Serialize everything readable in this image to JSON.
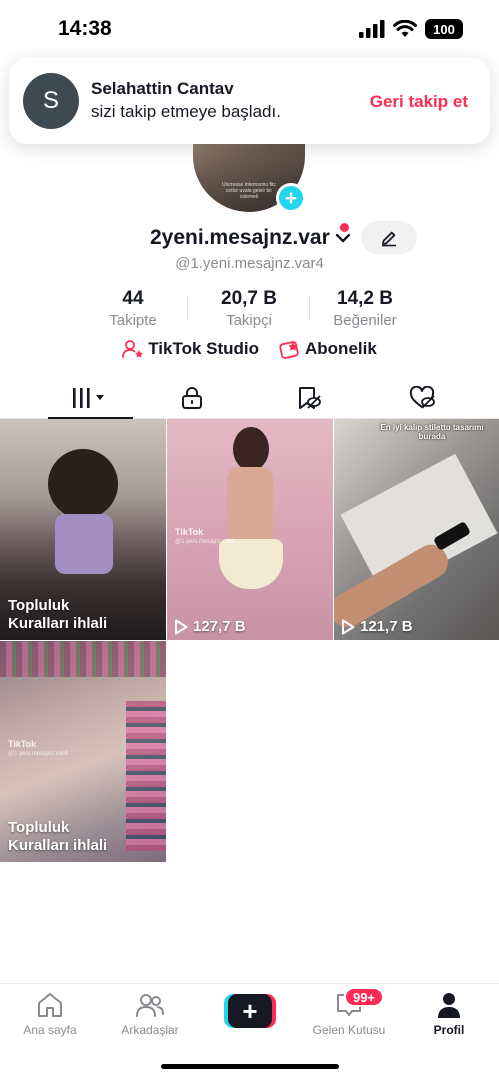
{
  "status_bar": {
    "time": "14:38",
    "battery": "100"
  },
  "notification": {
    "avatar_letter": "S",
    "name": "Selahattin Cantav",
    "message": "sizi takip etmeye başladı.",
    "action": "Geri takip et"
  },
  "profile": {
    "pic_caption": "Uncrease internsonu fitc cotlur uvala gelelr bir celemeli",
    "username": "2yeni.mesajnz.var",
    "handle": "@1.yeni.mesajnz.var4"
  },
  "stats": [
    {
      "value": "44",
      "label": "Takipte"
    },
    {
      "value": "20,7 B",
      "label": "Takipçi"
    },
    {
      "value": "14,2 B",
      "label": "Beğeniler"
    }
  ],
  "links": {
    "studio": "TikTok Studio",
    "subscription": "Abonelik"
  },
  "videos": [
    {
      "label_line1": "Topluluk",
      "label_line2": "Kuralları ihlali"
    },
    {
      "views": "127,7 B",
      "watermark": "TikTok",
      "watermark_sub": "@1.yeni.mesajnz.var4"
    },
    {
      "views": "121,7 B",
      "caption": "En iyi kalıp stiletto tasarımı burada"
    },
    {
      "label_line1": "Topluluk",
      "label_line2": "Kuralları ihlali",
      "watermark": "TikTok",
      "watermark_sub": "@1.yeni.mesajnz.var4"
    }
  ],
  "bottom_nav": {
    "home": "Ana sayfa",
    "friends": "Arkadaşlar",
    "inbox": "Gelen Kutusu",
    "inbox_badge": "99+",
    "profile": "Profil"
  },
  "colors": {
    "accent": "#fe2c55",
    "cyan": "#20d5ec",
    "text": "#161823",
    "muted": "#8a8b91"
  }
}
